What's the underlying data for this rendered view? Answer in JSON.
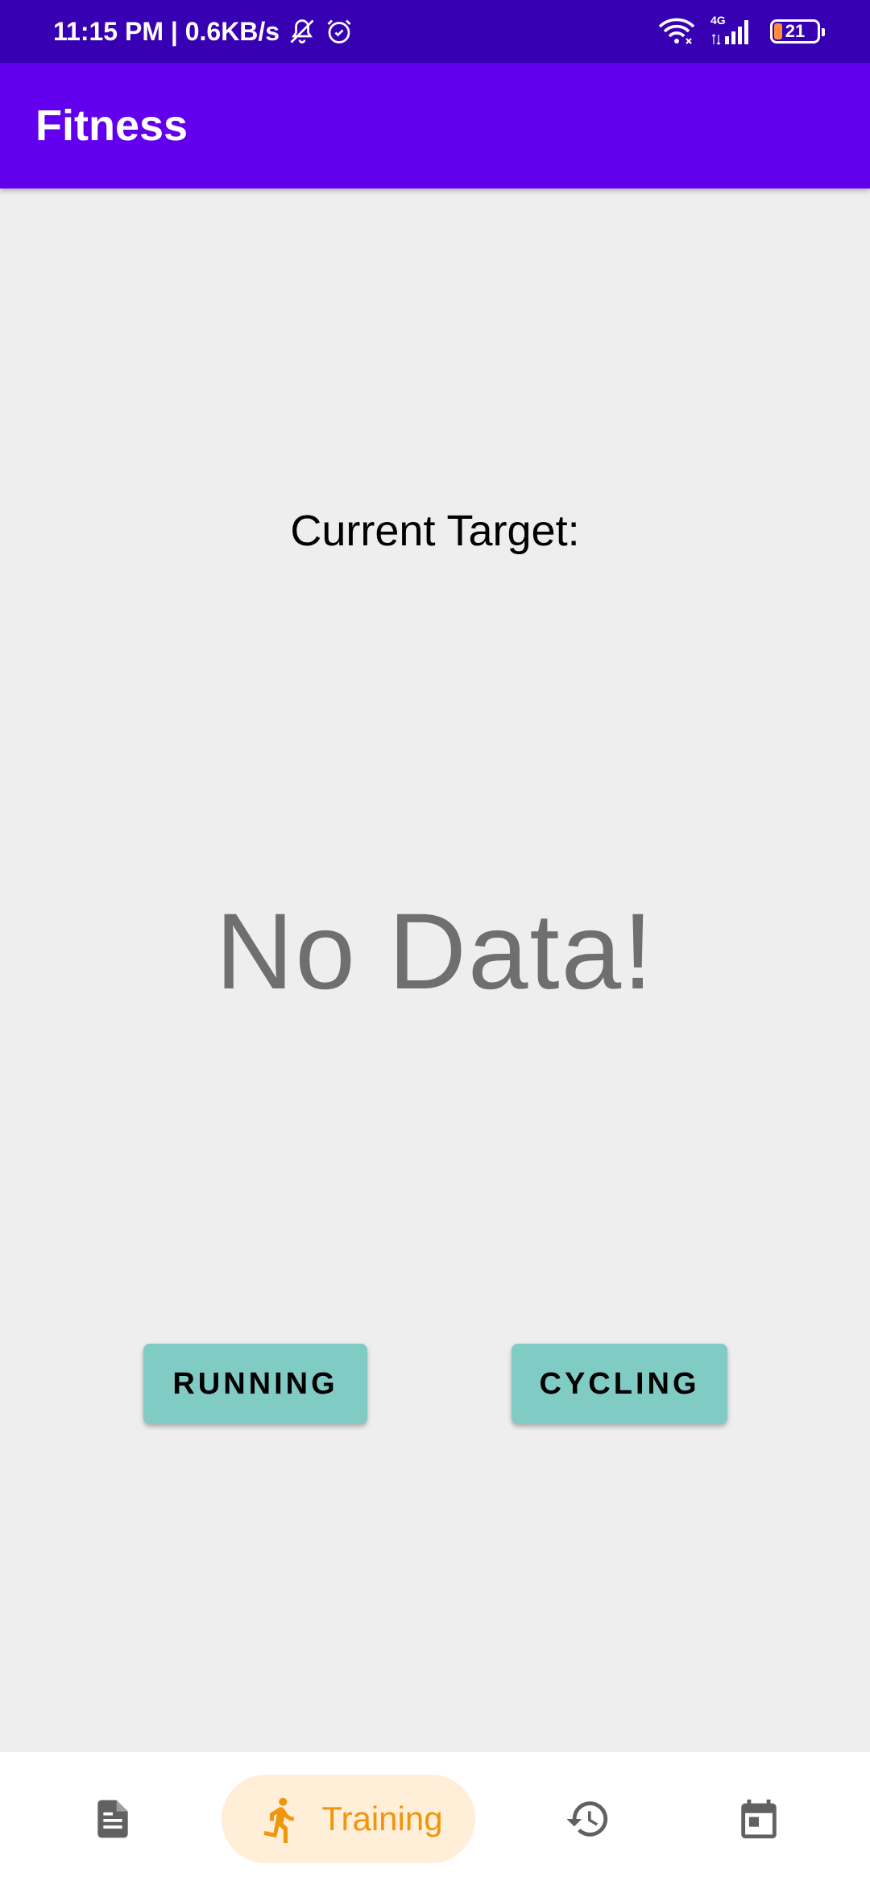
{
  "status_bar": {
    "time_speed": "11:15 PM | 0.6KB/s",
    "network_type": "4G",
    "battery_level": "21",
    "icons": [
      "bell-muted-icon",
      "alarm-icon",
      "wifi-icon",
      "signal-icon",
      "battery-icon"
    ]
  },
  "app_bar": {
    "title": "Fitness"
  },
  "main": {
    "target_label": "Current Target:",
    "no_data_text": "No Data!",
    "buttons": {
      "running_label": "RUNNING",
      "cycling_label": "CYCLING"
    }
  },
  "bottom_nav": {
    "items": [
      {
        "icon": "notes-icon",
        "label": ""
      },
      {
        "icon": "running-icon",
        "label": "Training",
        "selected": true
      },
      {
        "icon": "history-icon",
        "label": ""
      },
      {
        "icon": "calendar-icon",
        "label": ""
      }
    ]
  },
  "colors": {
    "status_bar": "#3700b3",
    "app_bar": "#6200ee",
    "background": "#eeeeee",
    "button": "#80cbc4",
    "nav_selected_bg": "#ffeed8",
    "nav_selected_fg": "#f0960c",
    "nav_icon": "#616161"
  }
}
